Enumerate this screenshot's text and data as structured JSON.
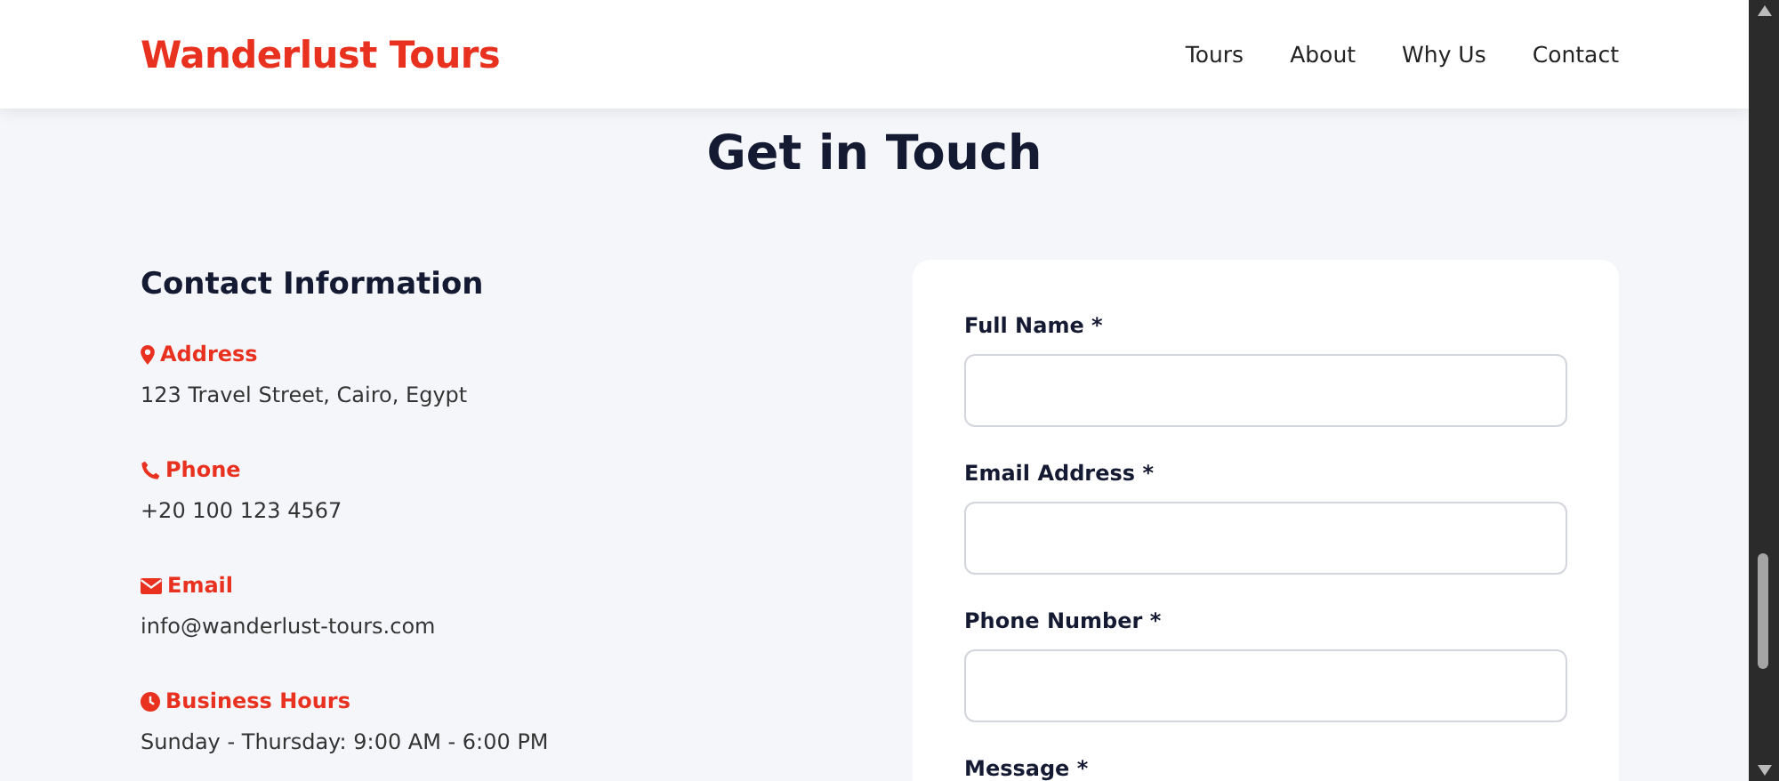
{
  "header": {
    "logo": "Wanderlust Tours",
    "nav": [
      "Tours",
      "About",
      "Why Us",
      "Contact"
    ]
  },
  "title": "Get in Touch",
  "contact": {
    "heading": "Contact Information",
    "items": [
      {
        "kind": "address",
        "label": "Address",
        "value": "123 Travel Street, Cairo, Egypt"
      },
      {
        "kind": "phone",
        "label": "Phone",
        "value": "+20 100 123 4567"
      },
      {
        "kind": "email",
        "label": "Email",
        "value": "info@wanderlust-tours.com"
      },
      {
        "kind": "hours",
        "label": "Business Hours",
        "value": "Sunday - Thursday: 9:00 AM - 6:00 PM"
      }
    ]
  },
  "form": {
    "fields": [
      {
        "kind": "input",
        "label": "Full Name *"
      },
      {
        "kind": "input",
        "label": "Email Address *"
      },
      {
        "kind": "input",
        "label": "Phone Number *"
      },
      {
        "kind": "label",
        "label": "Message *"
      }
    ]
  }
}
